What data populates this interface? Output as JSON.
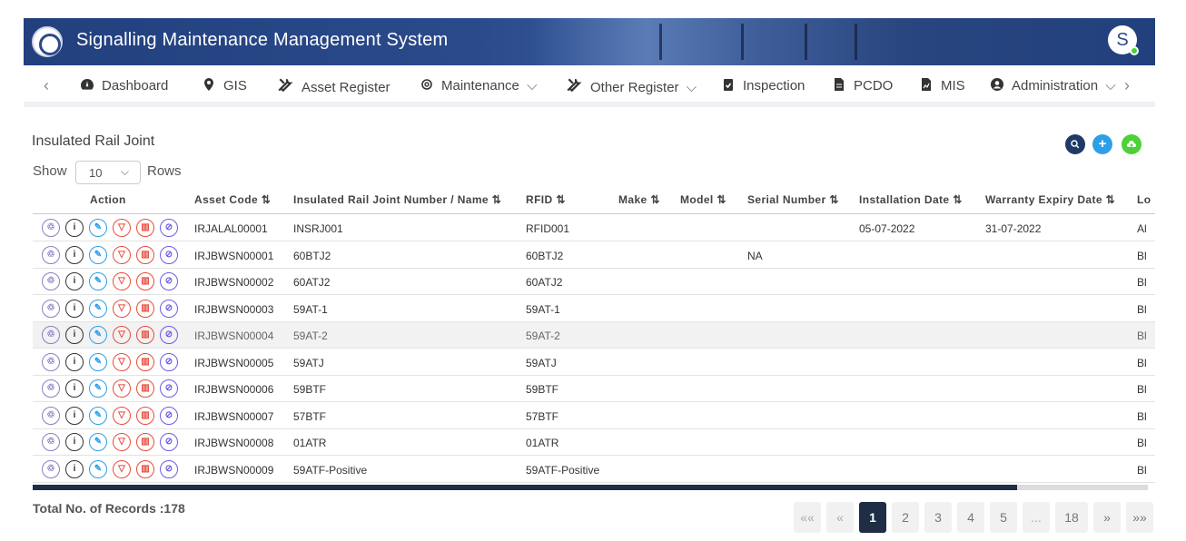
{
  "app": {
    "title": "Signalling Maintenance Management System",
    "user_initial": "S"
  },
  "nav": {
    "prev_arrow": "‹",
    "next_arrow": "›",
    "items": [
      {
        "label": "Dashboard",
        "icon": "dashboard-icon"
      },
      {
        "label": "GIS",
        "icon": "map-pin-icon"
      },
      {
        "label": "Asset Register",
        "icon": "tools-icon"
      },
      {
        "label": "Maintenance",
        "icon": "gear-icon",
        "chevron": "⌵"
      },
      {
        "label": "Other Register",
        "icon": "tools-icon",
        "chevron": "⌵"
      },
      {
        "label": "Inspection",
        "icon": "clipboard-check-icon"
      },
      {
        "label": "PCDO",
        "icon": "document-icon"
      },
      {
        "label": "MIS",
        "icon": "report-icon"
      },
      {
        "label": "Administration",
        "icon": "user-circle-icon",
        "chevron": "⌵"
      }
    ]
  },
  "page": {
    "title": "Insulated Rail Joint",
    "show_label": "Show",
    "rows_per_page": "10",
    "rows_label": "Rows",
    "total_records_label": "Total No. of Records :178"
  },
  "table": {
    "columns": [
      "Action",
      "Asset Code",
      "Insulated Rail Joint Number / Name",
      "RFID",
      "Make",
      "Model",
      "Serial Number",
      "Installation Date",
      "Warranty Expiry Date",
      "Lo"
    ],
    "sort_glyph": "⇅",
    "rows": [
      {
        "asset_code": "IRJALAL00001",
        "name": "INSRJ001",
        "rfid": "RFID001",
        "serial": "",
        "install": "05-07-2022",
        "warranty": "31-07-2022",
        "loc": "Al"
      },
      {
        "asset_code": "IRJBWSN00001",
        "name": "60BTJ2",
        "rfid": "60BTJ2",
        "serial": "NA",
        "install": "",
        "warranty": "",
        "loc": "Bl"
      },
      {
        "asset_code": "IRJBWSN00002",
        "name": "60ATJ2",
        "rfid": "60ATJ2",
        "serial": "",
        "install": "",
        "warranty": "",
        "loc": "Bl"
      },
      {
        "asset_code": "IRJBWSN00003",
        "name": "59AT-1",
        "rfid": "59AT-1",
        "serial": "",
        "install": "",
        "warranty": "",
        "loc": "Bl"
      },
      {
        "asset_code": "IRJBWSN00004",
        "name": "59AT-2",
        "rfid": "59AT-2",
        "serial": "",
        "install": "",
        "warranty": "",
        "loc": "Bl"
      },
      {
        "asset_code": "IRJBWSN00005",
        "name": "59ATJ",
        "rfid": "59ATJ",
        "serial": "",
        "install": "",
        "warranty": "",
        "loc": "Bl"
      },
      {
        "asset_code": "IRJBWSN00006",
        "name": "59BTF",
        "rfid": "59BTF",
        "serial": "",
        "install": "",
        "warranty": "",
        "loc": "Bl"
      },
      {
        "asset_code": "IRJBWSN00007",
        "name": "57BTF",
        "rfid": "57BTF",
        "serial": "",
        "install": "",
        "warranty": "",
        "loc": "Bl"
      },
      {
        "asset_code": "IRJBWSN00008",
        "name": "01ATR",
        "rfid": "01ATR",
        "serial": "",
        "install": "",
        "warranty": "",
        "loc": "Bl"
      },
      {
        "asset_code": "IRJBWSN00009",
        "name": "59ATF-Positive",
        "rfid": "59ATF-Positive",
        "serial": "",
        "install": "",
        "warranty": "",
        "loc": "Bl"
      }
    ],
    "action_buttons": [
      {
        "name": "transfer-icon",
        "glyph": "♲",
        "color": "#8e7cc3"
      },
      {
        "name": "info-icon",
        "glyph": "i",
        "color": "#333333"
      },
      {
        "name": "edit-icon",
        "glyph": "✎",
        "color": "#2e9fe6"
      },
      {
        "name": "thumbs-down-icon",
        "glyph": "▽",
        "color": "#e74c3c"
      },
      {
        "name": "trash-icon",
        "glyph": "▥",
        "color": "#e74c3c"
      },
      {
        "name": "attachment-icon",
        "glyph": "⊘",
        "color": "#6c5ce7"
      }
    ]
  },
  "pagination": {
    "first": "««",
    "prev": "«",
    "pages": [
      "1",
      "2",
      "3",
      "4",
      "5",
      "...",
      "18"
    ],
    "current": "1",
    "next": "»",
    "last": "»»"
  },
  "colors": {
    "header_bg": "#22407e",
    "search_fab": "#1f3a66",
    "add_fab": "#2e9fe6",
    "upload_fab": "#4cd137",
    "active_page": "#1f2d45"
  }
}
